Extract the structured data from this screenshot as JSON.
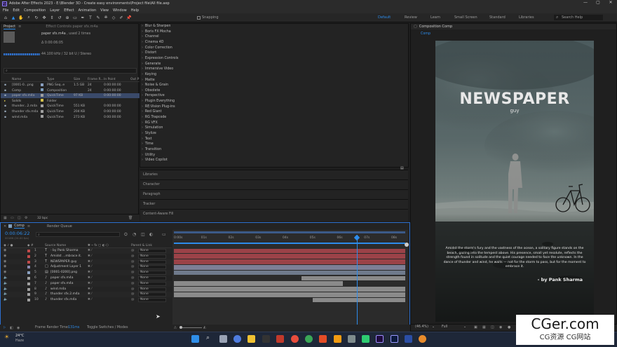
{
  "title": "Adobe After Effects 2023 - E:\\Blender 3D - Create easy environments\\Project file\\All file.aep",
  "menu": [
    "File",
    "Edit",
    "Composition",
    "Layer",
    "Effect",
    "Animation",
    "View",
    "Window",
    "Help"
  ],
  "toolbar": {
    "snapping_label": "Snapping"
  },
  "workspaces": [
    "Default",
    "Review",
    "Learn",
    "Small Screen",
    "Standard",
    "Libraries"
  ],
  "active_workspace": "Default",
  "search_help_placeholder": "Search Help",
  "project": {
    "tab": "Project",
    "effect_controls": "Effect Controls paper sfx.m4a",
    "selected_name": "paper sfx.m4a",
    "used": ", used 2 times",
    "duration": "Δ 0:00:06:05",
    "audio_info": "44.100 kHz / 32 bit U / Stereo",
    "search_placeholder": "",
    "columns": [
      "Name",
      "Type",
      "Size",
      "Frame R...",
      "In Point",
      "Out P"
    ],
    "items": [
      {
        "name": "[0001-0...png",
        "type": "PNG Seq..e",
        "size": "1.5 GB",
        "frame": "24",
        "in": "0:00:00:00",
        "color": "#8aa0c0",
        "sel": false
      },
      {
        "name": "Comp",
        "type": "Composition",
        "size": "",
        "frame": "24",
        "in": "0:00:00:00",
        "color": "#7f9fbf",
        "sel": false
      },
      {
        "name": "paper sfx.m4a",
        "type": "QuickTime",
        "size": "97 KB",
        "frame": "",
        "in": "0:00:00:00",
        "color": "#a0a0a0",
        "sel": true
      },
      {
        "name": "Solids",
        "type": "Folder",
        "size": "",
        "frame": "",
        "in": "",
        "color": "#d6c34a",
        "sel": false
      },
      {
        "name": "thunder...2.m4a",
        "type": "QuickTime",
        "size": "551 KB",
        "frame": "",
        "in": "0:00:00:00",
        "color": "#a0a0a0",
        "sel": false
      },
      {
        "name": "thunder sfx.m4a",
        "type": "QuickTime",
        "size": "204 KB",
        "frame": "",
        "in": "0:00:00:00",
        "color": "#a0a0a0",
        "sel": false
      },
      {
        "name": "wind.m4a",
        "type": "QuickTime",
        "size": "273 KB",
        "frame": "",
        "in": "0:00:00:00",
        "color": "#a0a0a0",
        "sel": false
      }
    ],
    "bpc": "32 bpc"
  },
  "effects": [
    "Blur & Sharpen",
    "Boris FX Mocha",
    "Channel",
    "Cinema 4D",
    "Color Correction",
    "Distort",
    "Expression Controls",
    "Generate",
    "Immersive Video",
    "Keying",
    "Matte",
    "Noise & Grain",
    "Obsolete",
    "Perspective",
    "Plugin Everything",
    "RE:Vision Plug-ins",
    "Red Giant",
    "RG Trapcode",
    "RG VFX",
    "Simulation",
    "Stylize",
    "Text",
    "Time",
    "Transition",
    "Utility",
    "Video Copilot"
  ],
  "side_panels": [
    "Libraries",
    "Character",
    "Paragraph",
    "Tracker",
    "Content-Aware Fill"
  ],
  "composition": {
    "tab": "Composition Comp",
    "sub_tab": "Comp",
    "zoom": "(46.4%)",
    "resolution": "Full",
    "headline": "NEWSPAPER",
    "subhead": "guy",
    "body": "Amidst the storm's fury and the vastness of the ocean, a solitary figure stands on the beach, gazing into the tempest above. His presence, small yet resolute, reflects the strength found in solitude and the quiet courage needed to face the unknown. In the dance of thunder and wind, he waits — not for the storm to pass, but for the moment to embrace it.",
    "byline": "- by Pank Sharma"
  },
  "timeline": {
    "tab": "Comp",
    "render_queue": "Render Queue",
    "timecode": "0:00:06:22",
    "timecode_sub": "00166 (24.00 fps)",
    "columns": {
      "source": "Source Name",
      "parent": "Parent & Link"
    },
    "ruler": [
      "0:00s",
      "01s",
      "02s",
      "03s",
      "04s",
      "05s",
      "06s",
      "07s",
      "08s"
    ],
    "playhead_frac": 0.79,
    "layers": [
      {
        "n": "1",
        "type": "T",
        "name": "- by Pank Sharma",
        "label": "#c04a4a",
        "par": "None",
        "bar_start": 0.0,
        "bar_end": 1.0,
        "bar_color": "#9b4248"
      },
      {
        "n": "2",
        "type": "T",
        "name": "Amidst ...mbrace it.",
        "label": "#c04a4a",
        "par": "None",
        "bar_start": 0.0,
        "bar_end": 1.0,
        "bar_color": "#9b4248"
      },
      {
        "n": "3",
        "type": "T",
        "name": "NEWSPAPER guy",
        "label": "#c04a4a",
        "par": "None",
        "bar_start": 0.0,
        "bar_end": 1.0,
        "bar_color": "#9b4248"
      },
      {
        "n": "4",
        "type": "□",
        "name": "Adjustment Layer 1",
        "label": "#8a8ab0",
        "par": "None",
        "bar_start": 0.0,
        "bar_end": 1.0,
        "bar_color": "#7d7f96"
      },
      {
        "n": "5",
        "type": "▤",
        "name": "[0001-0200].png",
        "label": "#8aa0c0",
        "par": "None",
        "bar_start": 0.0,
        "bar_end": 1.0,
        "bar_color": "#6f7a8c"
      },
      {
        "n": "6",
        "type": "♪",
        "name": "paper sfx.m4a",
        "label": "#a0a0a0",
        "par": "None",
        "bar_start": 0.55,
        "bar_end": 1.0,
        "bar_color": "#8a8a8a"
      },
      {
        "n": "7",
        "type": "♪",
        "name": "paper sfx.m4a",
        "label": "#a0a0a0",
        "par": "None",
        "bar_start": 0.0,
        "bar_end": 0.73,
        "bar_color": "#8a8a8a"
      },
      {
        "n": "8",
        "type": "♪",
        "name": "wind.m4a",
        "label": "#a0a0a0",
        "par": "None",
        "bar_start": 0.0,
        "bar_end": 1.0,
        "bar_color": "#8a8a8a"
      },
      {
        "n": "9",
        "type": "♪",
        "name": "thunder sfx.2.m4a",
        "label": "#a0a0a0",
        "par": "None",
        "bar_start": 0.0,
        "bar_end": 1.0,
        "bar_color": "#8a8a8a"
      },
      {
        "n": "10",
        "type": "♪",
        "name": "thunder sfx.m4a",
        "label": "#a0a0a0",
        "par": "None",
        "bar_start": 0.6,
        "bar_end": 1.0,
        "bar_color": "#8a8a8a"
      }
    ],
    "footer_render": "Frame Render Time:",
    "footer_render_value": "131ms",
    "footer_toggle": "Toggle Switches / Modes"
  },
  "taskbar": {
    "temp": "24°C",
    "weather": "Haze"
  },
  "watermark": {
    "main": "CGer.com",
    "sub": "CG资源  CG网站"
  },
  "colors": {
    "accent": "#2d8ceb",
    "headline": "#e8e8e8"
  }
}
